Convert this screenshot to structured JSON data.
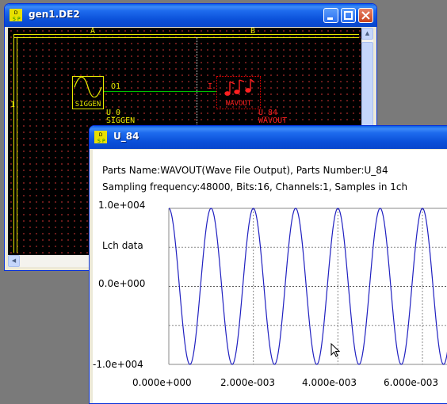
{
  "gen1_window": {
    "title": "gen1.DE2",
    "icon": "dsp-icon",
    "columns": [
      "A",
      "B"
    ],
    "rows": [
      "1"
    ],
    "siggen": {
      "block_label": "SIGGEN",
      "pin": "O1",
      "instance": "U_0",
      "type": "SIGGEN"
    },
    "wavout": {
      "block_label": "WAVOUT",
      "pin": "I",
      "instance": "U_84",
      "type": "WAVOUT"
    },
    "colors": {
      "grid_frame": "#e8e800",
      "wire": "#00c000",
      "wavout": "#ff2020"
    }
  },
  "u84_window": {
    "title": "U_84",
    "icon": "dsp-icon",
    "line1": "Parts Name:WAVOUT(Wave File Output), Parts Number:U_84",
    "line2": "Sampling frequency:48000, Bits:16, Channels:1, Samples in 1ch",
    "channel_label": "Lch data"
  },
  "chart_data": {
    "type": "line",
    "title": "",
    "xlabel": "",
    "ylabel": "",
    "ylim": [
      -10000,
      10000
    ],
    "xlim": [
      0,
      0.0066
    ],
    "y_ticks": [
      "1.0e+004",
      "0.0e+000",
      "-1.0e+004"
    ],
    "x_ticks": [
      "0.000e+000",
      "2.000e-003",
      "4.000e-003",
      "6.000e-003"
    ],
    "x_tick_values": [
      0,
      0.002,
      0.004,
      0.006
    ],
    "grid": true,
    "series": [
      {
        "frequency_hz": 1000,
        "amplitude": 10000,
        "sample_rate": 48000,
        "color": "#2020c0"
      }
    ]
  }
}
